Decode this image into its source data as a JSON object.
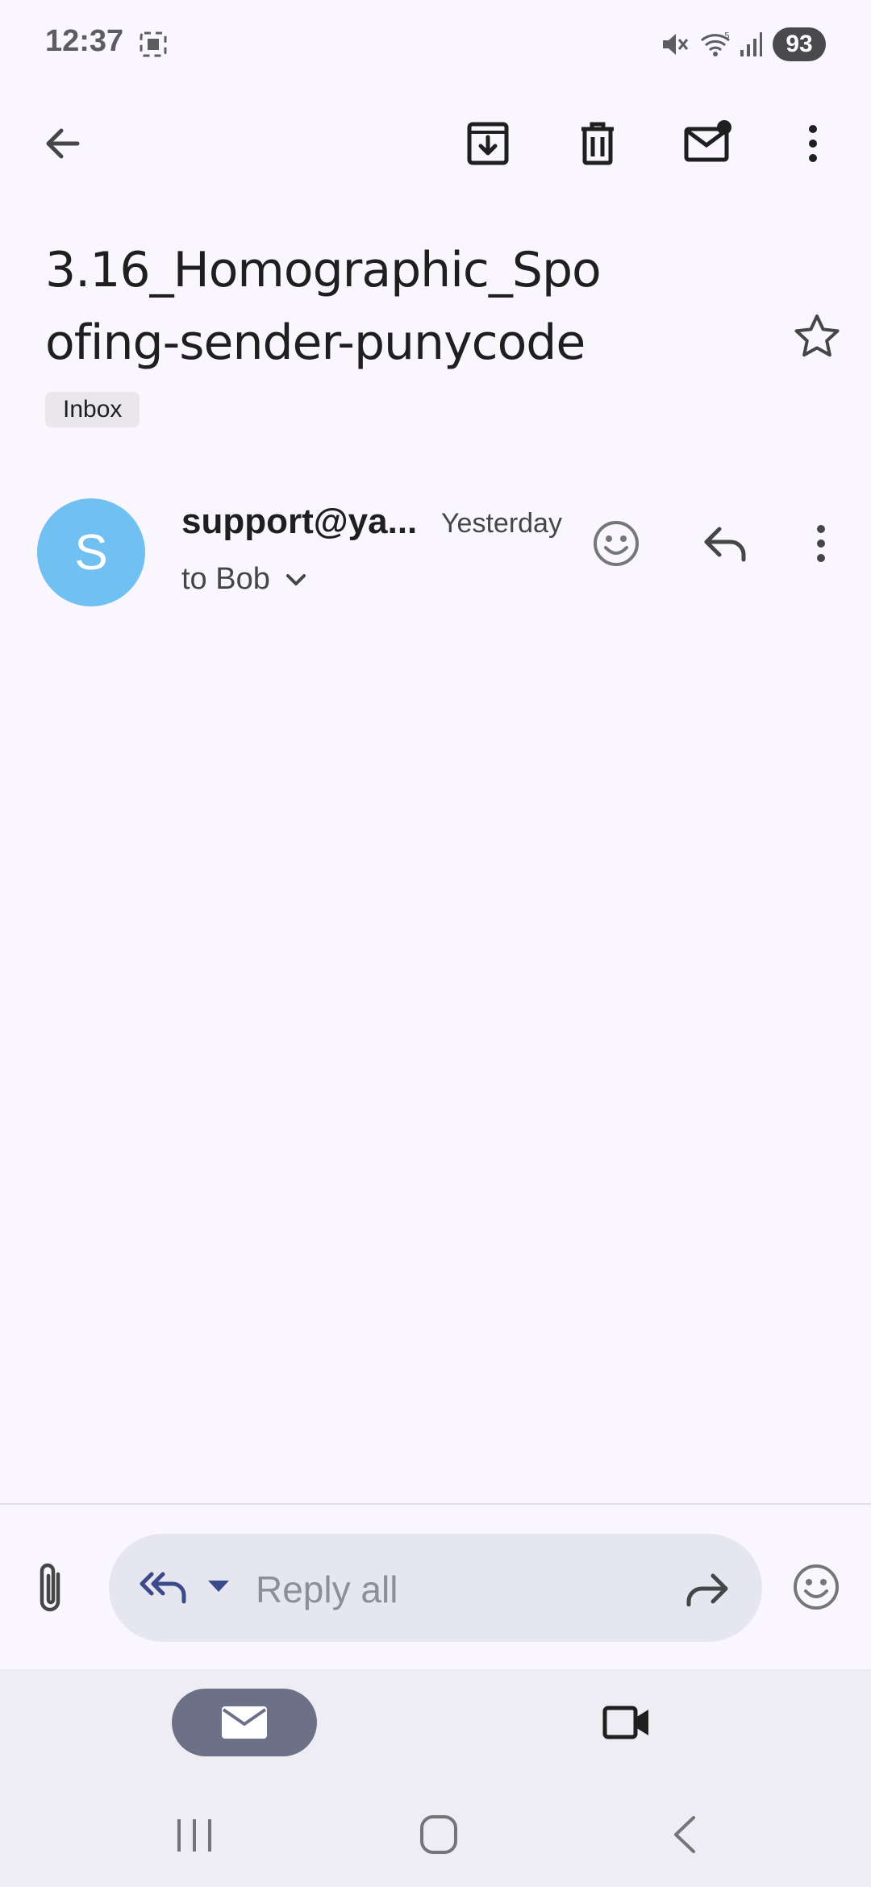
{
  "status_bar": {
    "time": "12:37",
    "battery": "93"
  },
  "toolbar": {
    "back_icon": "arrow-left-icon",
    "archive_icon": "archive-icon",
    "delete_icon": "trash-icon",
    "mark_unread_icon": "mail-unread-icon",
    "more_icon": "more-vert-icon"
  },
  "email": {
    "subject": "3.16_Homographic_Spoofing-sender-punycode",
    "label": "Inbox",
    "sender_initial": "S",
    "sender": "support@ya...",
    "time": "Yesterday",
    "recipient": "to Bob"
  },
  "reply_bar": {
    "placeholder": "Reply all"
  },
  "colors": {
    "background": "#f9f6fd",
    "avatar": "#70c0f1",
    "reply_pill": "#e6e6f0",
    "nav_active": "#6c7187"
  }
}
